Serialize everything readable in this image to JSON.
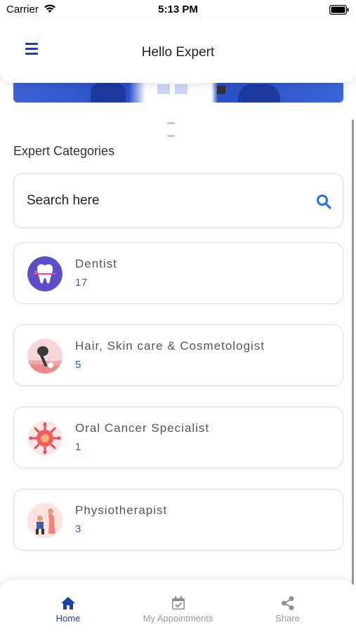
{
  "status_bar": {
    "carrier": "Carrier",
    "time": "5:13 PM"
  },
  "header": {
    "title": "Hello Expert",
    "menu_icon": "hamburger-icon"
  },
  "section_title": "Expert Categories",
  "search": {
    "placeholder": "Search here",
    "value": "",
    "icon": "search-icon"
  },
  "categories": [
    {
      "name": "Dentist",
      "count": "17",
      "icon": "tooth-icon"
    },
    {
      "name": "Hair, Skin care & Cosmetologist",
      "count": "5",
      "icon": "hair-follicle-icon"
    },
    {
      "name": "Oral Cancer Specialist",
      "count": "1",
      "icon": "cancer-cell-icon"
    },
    {
      "name": "Physiotherapist",
      "count": "3",
      "icon": "physiotherapy-icon"
    }
  ],
  "bottom_nav": [
    {
      "label": "Home",
      "icon": "home-icon",
      "active": true
    },
    {
      "label": "My Appointments",
      "icon": "calendar-check-icon",
      "active": false
    },
    {
      "label": "Share",
      "icon": "share-icon",
      "active": false
    }
  ],
  "colors": {
    "accent": "#1f3fa8",
    "count": "#2c5bd3",
    "search_icon": "#1e73e8",
    "inactive_nav": "#9a9a9a"
  }
}
